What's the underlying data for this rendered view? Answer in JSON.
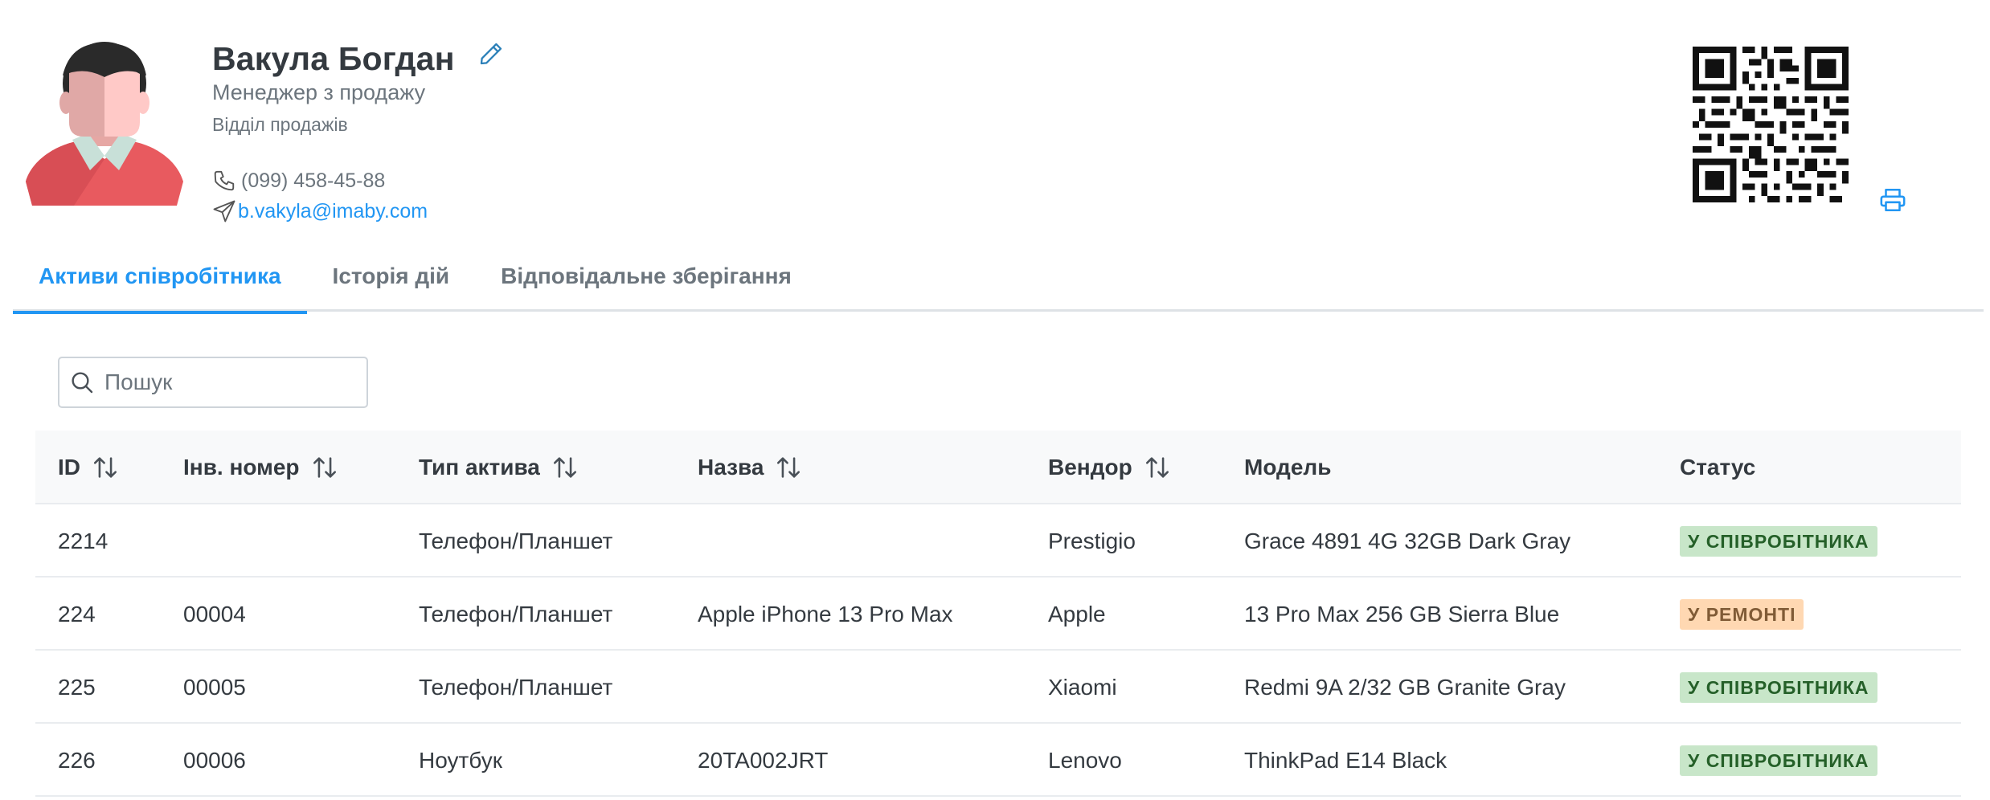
{
  "profile": {
    "name": "Вакула Богдан",
    "position": "Менеджер з продажу",
    "department": "Відділ продажів",
    "phone": "(099) 458-45-88",
    "email": "b.vakyla@imaby.com"
  },
  "tabs": [
    {
      "label": "Активи співробітника",
      "active": true
    },
    {
      "label": "Історія дій",
      "active": false
    },
    {
      "label": "Відповідальне зберігання",
      "active": false
    }
  ],
  "search": {
    "placeholder": "Пошук",
    "value": ""
  },
  "table": {
    "headers": [
      "ID",
      "Інв. номер",
      "Тип актива",
      "Назва",
      "Вендор",
      "Модель",
      "Статус"
    ],
    "rows": [
      [
        "2214",
        "",
        "Телефон/Планшет",
        "",
        "Prestigio",
        "Grace 4891 4G 32GB Dark Gray",
        "У СПІВРОБІТНИКА"
      ],
      [
        "224",
        "00004",
        "Телефон/Планшет",
        "Apple iPhone 13 Pro Max",
        "Apple",
        "13 Pro Max 256 GB Sierra Blue",
        "У РЕМОНТІ"
      ],
      [
        "225",
        "00005",
        "Телефон/Планшет",
        "",
        "Xiaomi",
        "Redmi 9A 2/32 GB Granite Gray",
        "У СПІВРОБІТНИКА"
      ],
      [
        "226",
        "00006",
        "Ноутбук",
        "20TA002JRT",
        "Lenovo",
        "ThinkPad E14 Black",
        "У СПІВРОБІТНИКА"
      ]
    ],
    "status_styles": {
      "У СПІВРОБІТНИКА": "ok",
      "У РЕМОНТІ": "repair"
    }
  },
  "colors": {
    "accent": "#2196f3",
    "status_ok_bg": "#c8e6c9",
    "status_ok_text": "#256029",
    "status_repair_bg": "#ffd8b2",
    "status_repair_text": "#805b36"
  },
  "icons": [
    "avatar-illustration",
    "edit-pencil-icon",
    "phone-icon",
    "send-icon",
    "qr-code",
    "print-icon",
    "search-icon",
    "sort-icon"
  ]
}
